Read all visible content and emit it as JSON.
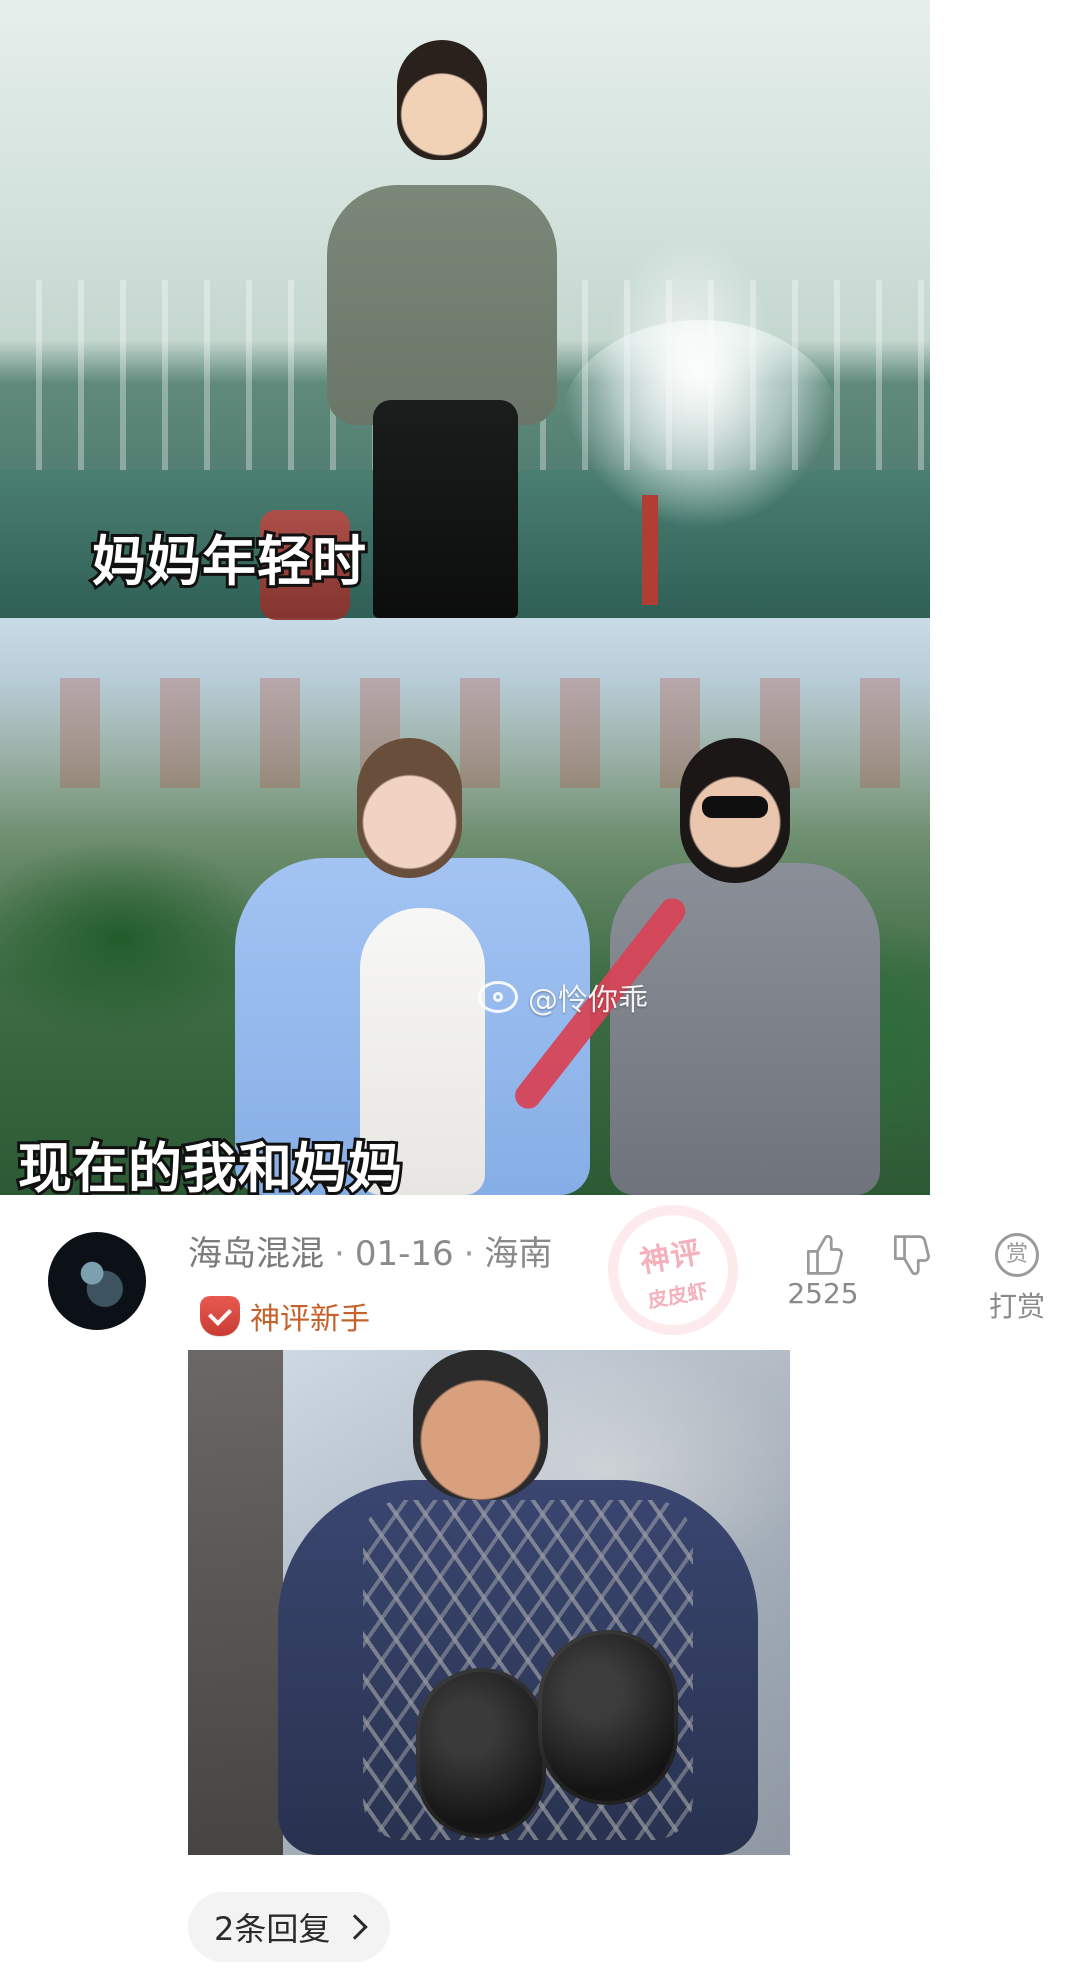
{
  "post": {
    "captions": {
      "top": "妈妈年轻时",
      "bottom": "现在的我和妈妈"
    },
    "watermark": {
      "text": "@怜你乖"
    }
  },
  "comment": {
    "username": "海岛混混",
    "date": "01-16",
    "location": "海南",
    "badge_label": "神评新手",
    "stamp": {
      "main": "神评",
      "sub": "皮皮虾"
    },
    "actions": {
      "like_count": "2525",
      "tip_label": "打赏",
      "tip_icon_char": "赏"
    },
    "replies_label": "2条回复"
  },
  "icons": {
    "thumb_up": "thumb-up-icon",
    "thumb_down": "thumb-down-icon",
    "tip": "tip-icon",
    "chevron": "chevron-right-icon"
  },
  "colors": {
    "meta_gray": "#7c7c7c",
    "badge_orange": "#c5622b",
    "stamp_pink": "#ea687e",
    "pill_bg": "#f3f3f3"
  }
}
